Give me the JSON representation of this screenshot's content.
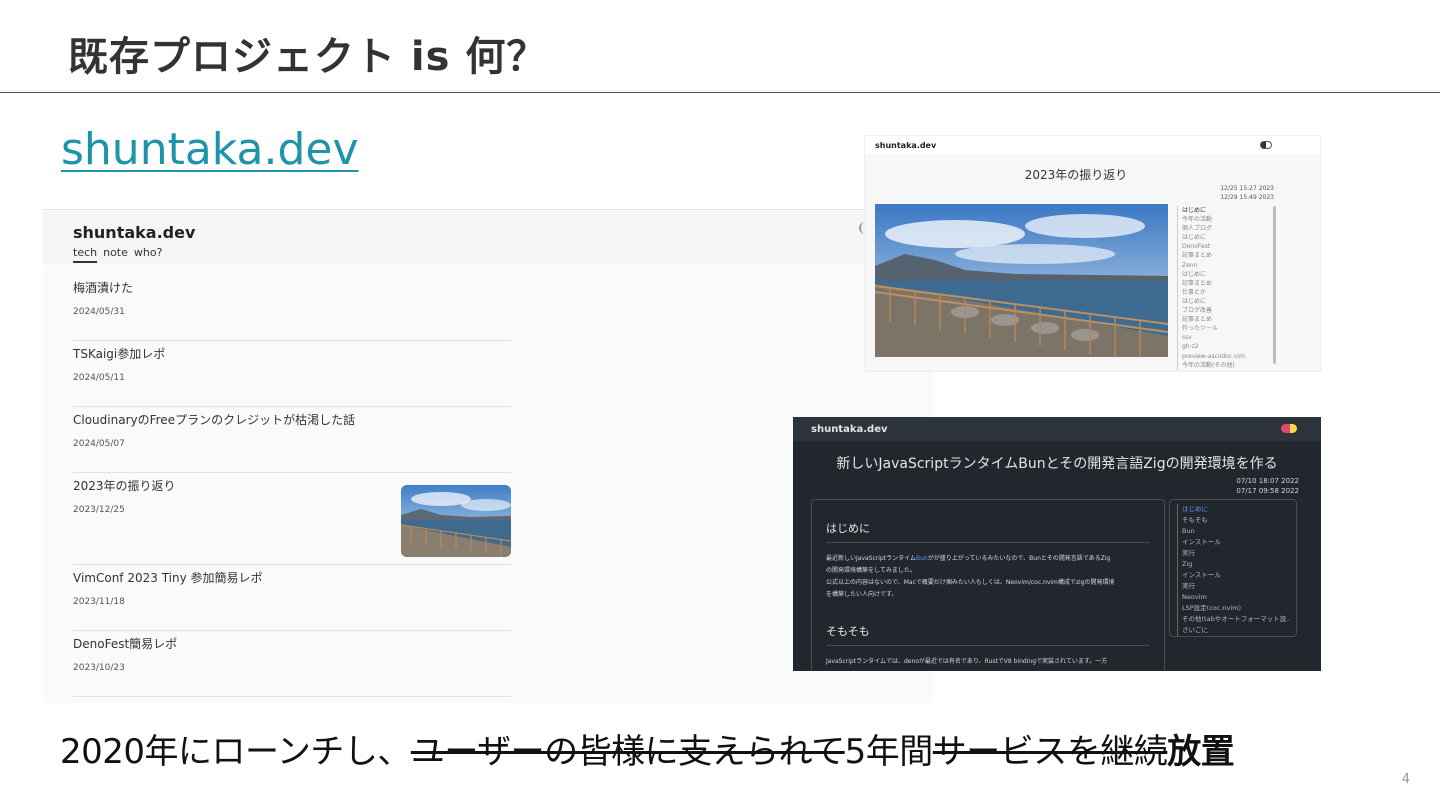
{
  "slide": {
    "title": "既存プロジェクト is 何？",
    "link_text": "shuntaka.dev",
    "page_number": "4"
  },
  "blog": {
    "brand": "shuntaka.dev",
    "nav": [
      "tech",
      "note",
      "who?"
    ],
    "posts": [
      {
        "title": "梅酒漬けた",
        "date": "2024/05/31"
      },
      {
        "title": "TSKaigi参加レポ",
        "date": "2024/05/11"
      },
      {
        "title": "CloudinaryのFreeプランのクレジットが枯渇した話",
        "date": "2024/05/07"
      },
      {
        "title": "2023年の振り返り",
        "date": "2023/12/25"
      },
      {
        "title": "VimConf 2023 Tiny 参加簡易レポ",
        "date": "2023/11/18"
      },
      {
        "title": "DenoFest簡易レポ",
        "date": "2023/10/23"
      }
    ]
  },
  "light_article": {
    "brand": "shuntaka.dev",
    "title": "2023年の振り返り",
    "created": "12/25 15:27 2023",
    "updated": "12/29 15:49 2023",
    "toc": [
      "はじめに",
      "今年の活動",
      "個人ブログ",
      "はじめに",
      "DenoFest",
      "記事まとめ",
      "Zenn",
      "はじめに",
      "記事まとめ",
      "仕事とか",
      "はじめに",
      "ブログ改善",
      "記事まとめ",
      "作ったツール",
      "ssv",
      "gh-z2",
      "preview-asciidoc.vim",
      "今年の活動(その他)"
    ]
  },
  "dark_article": {
    "brand": "shuntaka.dev",
    "title": "新しいJavaScriptランタイムBunとその開発言語Zigの開発環境を作る",
    "created": "07/10 18:07 2022",
    "updated": "07/17 09:58 2022",
    "section1": "はじめに",
    "para1_a": "最近新しいJavaScriptランタイム",
    "para1_link": "Bun",
    "para1_b": "がが盛り上がっているみたいなので、Bunとその開発言語であるZig",
    "para1_c": "の開発環境構築をしてみました。",
    "para1_d": "公式以上の内容はないので、Macで概要だけ掴みたい人もしくは、Neovim/coc.nvim構成でzigの開発環境",
    "para1_e": "を構築したい人向けです。",
    "section2": "そもそも",
    "para2": "JavaScriptランタイムでは、denoが最近では有名であり、RustでV8 bindingで実装されています。一方",
    "toc": [
      "はじめに",
      "そもそも",
      "Bun",
      "インストール",
      "実行",
      "Zig",
      "インストール",
      "実行",
      "Neovim",
      "LSP設定(coc.nvim)",
      "その他(tabやオートフォーマット設...",
      "さいごに"
    ]
  },
  "caption": {
    "plain": "2020年にローンチし、",
    "struck1": "ユーザーの皆様に支えられて",
    "plain2": "5年間",
    "struck2": "サービスを継続",
    "bold": "放置"
  }
}
